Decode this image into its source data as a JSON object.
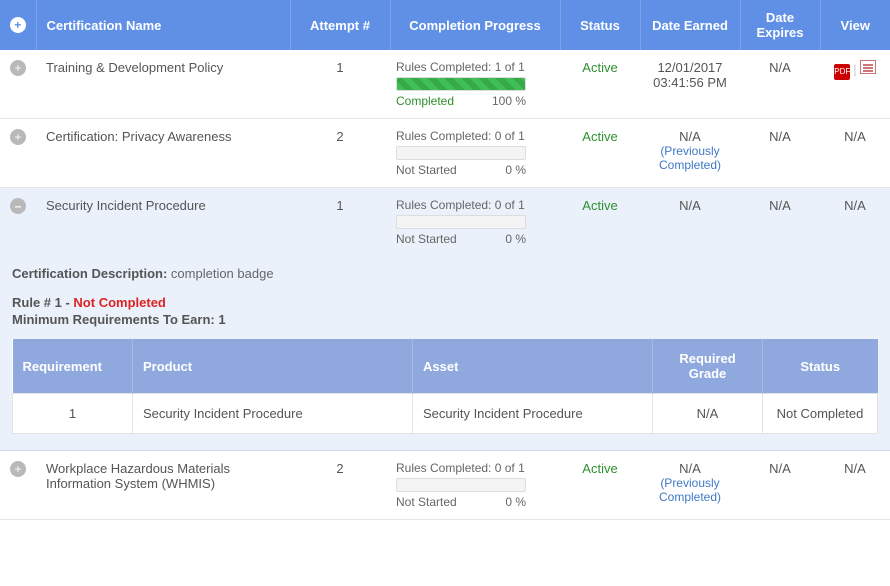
{
  "columns": {
    "name": "Certification Name",
    "attempt": "Attempt #",
    "progress": "Completion Progress",
    "status": "Status",
    "earned": "Date Earned",
    "expires": "Date Expires",
    "view": "View"
  },
  "rows": [
    {
      "expanded": false,
      "name": "Training & Development Policy",
      "attempt": "1",
      "progress": {
        "text": "Rules Completed: 1 of 1",
        "fill_pct": 100,
        "state_label": "Completed",
        "state_class": "completed",
        "pct_label": "100 %"
      },
      "status": "Active",
      "earned": "12/01/2017 03:41:56 PM",
      "earned_prev": "",
      "expires": "N/A",
      "view": "icons"
    },
    {
      "expanded": false,
      "name": "Certification: Privacy Awareness",
      "attempt": "2",
      "progress": {
        "text": "Rules Completed: 0 of 1",
        "fill_pct": 0,
        "state_label": "Not Started",
        "state_class": "notstarted",
        "pct_label": "0 %"
      },
      "status": "Active",
      "earned": "N/A",
      "earned_prev": "(Previously Completed)",
      "expires": "N/A",
      "view": "N/A"
    },
    {
      "expanded": true,
      "name": "Security Incident Procedure",
      "attempt": "1",
      "progress": {
        "text": "Rules Completed: 0 of 1",
        "fill_pct": 0,
        "state_label": "Not Started",
        "state_class": "notstarted",
        "pct_label": "0 %"
      },
      "status": "Active",
      "earned": "N/A",
      "earned_prev": "",
      "expires": "N/A",
      "view": "N/A"
    },
    {
      "expanded": false,
      "name": "Workplace Hazardous Materials Information System (WHMIS)",
      "attempt": "2",
      "progress": {
        "text": "Rules Completed: 0 of 1",
        "fill_pct": 0,
        "state_label": "Not Started",
        "state_class": "notstarted",
        "pct_label": "0 %"
      },
      "status": "Active",
      "earned": "N/A",
      "earned_prev": "(Previously Completed)",
      "expires": "N/A",
      "view": "N/A"
    }
  ],
  "detail": {
    "desc_label": "Certification Description:",
    "desc_value": "completion badge",
    "rule_label": "Rule # 1 -",
    "rule_status": "Not Completed",
    "min_req": "Minimum Requirements To Earn: 1",
    "req_columns": {
      "requirement": "Requirement",
      "product": "Product",
      "asset": "Asset",
      "required_grade": "Required Grade",
      "status": "Status"
    },
    "req_rows": [
      {
        "requirement": "1",
        "product": "Security Incident Procedure",
        "asset": "Security Incident Procedure",
        "required_grade": "N/A",
        "status": "Not Completed"
      }
    ]
  }
}
